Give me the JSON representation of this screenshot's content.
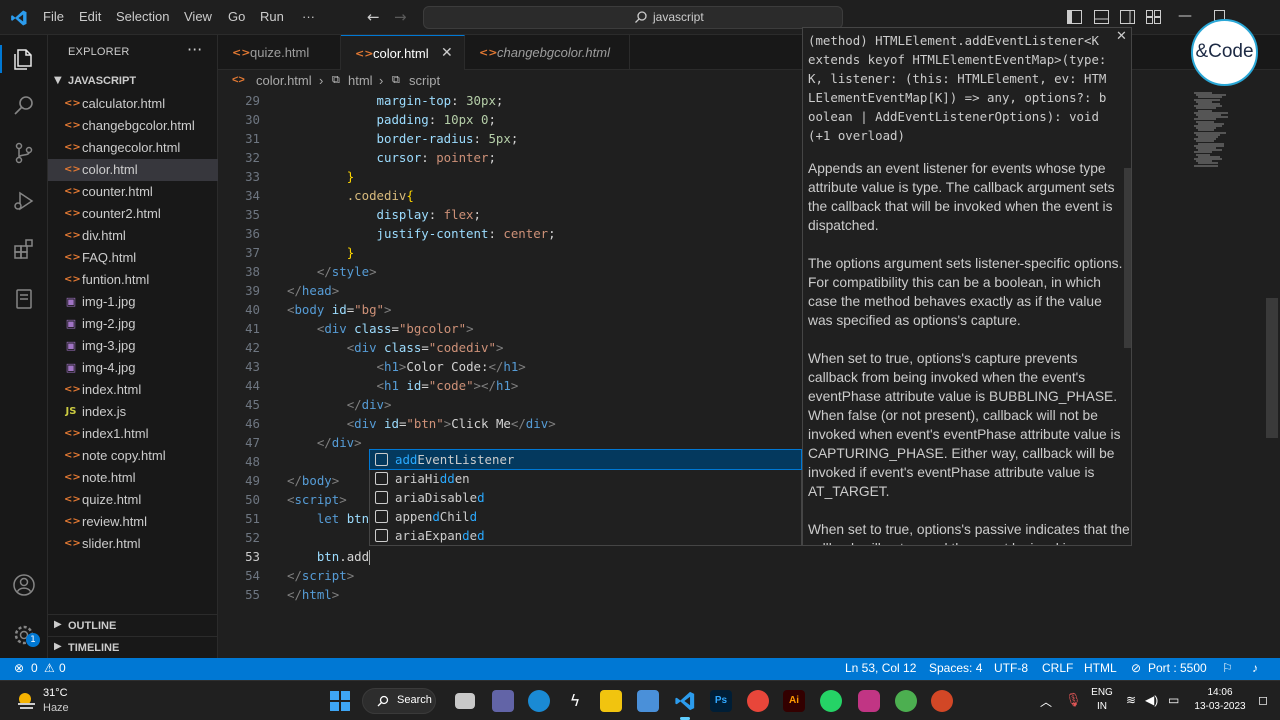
{
  "titlebar": {
    "menu": [
      "File",
      "Edit",
      "Selection",
      "View",
      "Go",
      "Run",
      "···"
    ],
    "search_text": "javascript"
  },
  "explorer": {
    "title": "EXPLORER",
    "more": "···",
    "folder": "JAVASCRIPT",
    "files": [
      {
        "name": "calculator.html",
        "kind": "html"
      },
      {
        "name": "changebgcolor.html",
        "kind": "html"
      },
      {
        "name": "changecolor.html",
        "kind": "html"
      },
      {
        "name": "color.html",
        "kind": "html",
        "selected": true
      },
      {
        "name": "counter.html",
        "kind": "html"
      },
      {
        "name": "counter2.html",
        "kind": "html"
      },
      {
        "name": "div.html",
        "kind": "html"
      },
      {
        "name": "FAQ.html",
        "kind": "html"
      },
      {
        "name": "funtion.html",
        "kind": "html"
      },
      {
        "name": "img-1.jpg",
        "kind": "image"
      },
      {
        "name": "img-2.jpg",
        "kind": "image"
      },
      {
        "name": "img-3.jpg",
        "kind": "image"
      },
      {
        "name": "img-4.jpg",
        "kind": "image"
      },
      {
        "name": "index.html",
        "kind": "html"
      },
      {
        "name": "index.js",
        "kind": "js"
      },
      {
        "name": "index1.html",
        "kind": "html"
      },
      {
        "name": "note copy.html",
        "kind": "html"
      },
      {
        "name": "note.html",
        "kind": "html"
      },
      {
        "name": "quize.html",
        "kind": "html"
      },
      {
        "name": "review.html",
        "kind": "html"
      },
      {
        "name": "slider.html",
        "kind": "html"
      }
    ],
    "outline": "OUTLINE",
    "timeline": "TIMELINE"
  },
  "tabs": [
    {
      "label": "quize.html",
      "active": false,
      "italic": false
    },
    {
      "label": "color.html",
      "active": true,
      "italic": false,
      "close": "✕"
    },
    {
      "label": "changebgcolor.html",
      "active": false,
      "italic": true
    }
  ],
  "breadcrumb": [
    "color.html",
    "html",
    "script"
  ],
  "editor": {
    "current_line": 53,
    "lines": [
      {
        "n": 29,
        "t": [
          [
            "            ",
            "t-text"
          ],
          [
            "margin-top",
            "t-prop"
          ],
          [
            ": ",
            "t-text"
          ],
          [
            "30px",
            "t-num"
          ],
          [
            ";",
            "t-text"
          ]
        ]
      },
      {
        "n": 30,
        "t": [
          [
            "            ",
            "t-text"
          ],
          [
            "padding",
            "t-prop"
          ],
          [
            ": ",
            "t-text"
          ],
          [
            "10px 0",
            "t-num"
          ],
          [
            ";",
            "t-text"
          ]
        ]
      },
      {
        "n": 31,
        "t": [
          [
            "            ",
            "t-text"
          ],
          [
            "border-radius",
            "t-prop"
          ],
          [
            ": ",
            "t-text"
          ],
          [
            "5px",
            "t-num"
          ],
          [
            ";",
            "t-text"
          ]
        ]
      },
      {
        "n": 32,
        "t": [
          [
            "            ",
            "t-text"
          ],
          [
            "cursor",
            "t-prop"
          ],
          [
            ": ",
            "t-text"
          ],
          [
            "pointer",
            "t-val"
          ],
          [
            ";",
            "t-text"
          ]
        ]
      },
      {
        "n": 33,
        "t": [
          [
            "        ",
            "t-text"
          ],
          [
            "}",
            "t-brace"
          ]
        ]
      },
      {
        "n": 34,
        "t": [
          [
            "        ",
            "t-text"
          ],
          [
            ".codediv",
            "t-sel"
          ],
          [
            "{",
            "t-brace"
          ]
        ]
      },
      {
        "n": 35,
        "t": [
          [
            "            ",
            "t-text"
          ],
          [
            "display",
            "t-prop"
          ],
          [
            ": ",
            "t-text"
          ],
          [
            "flex",
            "t-val"
          ],
          [
            ";",
            "t-text"
          ]
        ]
      },
      {
        "n": 36,
        "t": [
          [
            "            ",
            "t-text"
          ],
          [
            "justify-content",
            "t-prop"
          ],
          [
            ": ",
            "t-text"
          ],
          [
            "center",
            "t-val"
          ],
          [
            ";",
            "t-text"
          ]
        ]
      },
      {
        "n": 37,
        "t": [
          [
            "        ",
            "t-text"
          ],
          [
            "}",
            "t-brace"
          ]
        ]
      },
      {
        "n": 38,
        "t": [
          [
            "    ",
            "t-text"
          ],
          [
            "</",
            "t-tag"
          ],
          [
            "style",
            "t-name"
          ],
          [
            ">",
            "t-tag"
          ]
        ]
      },
      {
        "n": 39,
        "t": [
          [
            "</",
            "t-tag"
          ],
          [
            "head",
            "t-name"
          ],
          [
            ">",
            "t-tag"
          ]
        ]
      },
      {
        "n": 40,
        "t": [
          [
            "<",
            "t-tag"
          ],
          [
            "body",
            "t-name"
          ],
          [
            " ",
            "t-text"
          ],
          [
            "id",
            "t-attr"
          ],
          [
            "=",
            "t-text"
          ],
          [
            "\"bg\"",
            "t-str"
          ],
          [
            ">",
            "t-tag"
          ]
        ]
      },
      {
        "n": 41,
        "t": [
          [
            "    ",
            "t-text"
          ],
          [
            "<",
            "t-tag"
          ],
          [
            "div",
            "t-name"
          ],
          [
            " ",
            "t-text"
          ],
          [
            "class",
            "t-attr"
          ],
          [
            "=",
            "t-text"
          ],
          [
            "\"bgcolor\"",
            "t-str"
          ],
          [
            ">",
            "t-tag"
          ]
        ]
      },
      {
        "n": 42,
        "t": [
          [
            "        ",
            "t-text"
          ],
          [
            "<",
            "t-tag"
          ],
          [
            "div",
            "t-name"
          ],
          [
            " ",
            "t-text"
          ],
          [
            "class",
            "t-attr"
          ],
          [
            "=",
            "t-text"
          ],
          [
            "\"codediv\"",
            "t-str"
          ],
          [
            ">",
            "t-tag"
          ]
        ]
      },
      {
        "n": 43,
        "t": [
          [
            "            ",
            "t-text"
          ],
          [
            "<",
            "t-tag"
          ],
          [
            "h1",
            "t-name"
          ],
          [
            ">",
            "t-tag"
          ],
          [
            "Color Code:",
            "t-text"
          ],
          [
            "</",
            "t-tag"
          ],
          [
            "h1",
            "t-name"
          ],
          [
            ">",
            "t-tag"
          ]
        ]
      },
      {
        "n": 44,
        "t": [
          [
            "            ",
            "t-text"
          ],
          [
            "<",
            "t-tag"
          ],
          [
            "h1",
            "t-name"
          ],
          [
            " ",
            "t-text"
          ],
          [
            "id",
            "t-attr"
          ],
          [
            "=",
            "t-text"
          ],
          [
            "\"code\"",
            "t-str"
          ],
          [
            ">",
            "t-tag"
          ],
          [
            "</",
            "t-tag"
          ],
          [
            "h1",
            "t-name"
          ],
          [
            ">",
            "t-tag"
          ]
        ]
      },
      {
        "n": 45,
        "t": [
          [
            "        ",
            "t-text"
          ],
          [
            "</",
            "t-tag"
          ],
          [
            "div",
            "t-name"
          ],
          [
            ">",
            "t-tag"
          ]
        ]
      },
      {
        "n": 46,
        "t": [
          [
            "        ",
            "t-text"
          ],
          [
            "<",
            "t-tag"
          ],
          [
            "div",
            "t-name"
          ],
          [
            " ",
            "t-text"
          ],
          [
            "id",
            "t-attr"
          ],
          [
            "=",
            "t-text"
          ],
          [
            "\"btn\"",
            "t-str"
          ],
          [
            ">",
            "t-tag"
          ],
          [
            "Click Me",
            "t-text"
          ],
          [
            "</",
            "t-tag"
          ],
          [
            "div",
            "t-name"
          ],
          [
            ">",
            "t-tag"
          ]
        ]
      },
      {
        "n": 47,
        "t": [
          [
            "    ",
            "t-text"
          ],
          [
            "</",
            "t-tag"
          ],
          [
            "div",
            "t-name"
          ],
          [
            ">",
            "t-tag"
          ]
        ]
      },
      {
        "n": 48,
        "t": []
      },
      {
        "n": 49,
        "t": [
          [
            "</",
            "t-tag"
          ],
          [
            "body",
            "t-name"
          ],
          [
            ">",
            "t-tag"
          ]
        ]
      },
      {
        "n": 50,
        "t": [
          [
            "<",
            "t-tag"
          ],
          [
            "script",
            "t-name"
          ],
          [
            ">",
            "t-tag"
          ]
        ]
      },
      {
        "n": 51,
        "t": [
          [
            "    ",
            "t-text"
          ],
          [
            "let",
            "t-kw"
          ],
          [
            " ",
            "t-text"
          ],
          [
            "btn",
            "t-var"
          ]
        ]
      },
      {
        "n": 52,
        "t": []
      },
      {
        "n": 53,
        "t": [
          [
            "    ",
            "t-text"
          ],
          [
            "btn",
            "t-var"
          ],
          [
            ".add",
            "t-text"
          ]
        ]
      },
      {
        "n": 54,
        "t": [
          [
            "</",
            "t-tag"
          ],
          [
            "script",
            "t-name"
          ],
          [
            ">",
            "t-tag"
          ]
        ]
      },
      {
        "n": 55,
        "t": [
          [
            "</",
            "t-tag"
          ],
          [
            "html",
            "t-name"
          ],
          [
            ">",
            "t-tag"
          ]
        ]
      }
    ]
  },
  "suggestions": [
    {
      "match": "add",
      "rest": "EventListener",
      "focused": true
    },
    {
      "pre": "aria",
      "match": "",
      "rest": "Hidden",
      "hl": [
        [
          "ariaHi",
          ""
        ],
        [
          "dd",
          "b"
        ],
        [
          "en",
          ""
        ]
      ]
    },
    {
      "hl": [
        [
          "ariaDisable",
          ""
        ],
        [
          "d",
          "b"
        ]
      ]
    },
    {
      "hl": [
        [
          "appen",
          ""
        ],
        [
          "d",
          "b"
        ],
        [
          "Chil",
          ""
        ],
        [
          "d",
          "b"
        ]
      ]
    },
    {
      "hl": [
        [
          "ariaExpan",
          ""
        ],
        [
          "d",
          "b"
        ],
        [
          "e",
          ""
        ],
        [
          "d",
          "b"
        ]
      ]
    }
  ],
  "details": {
    "signature": "(method) HTMLElement.addEventListener<K extends keyof HTMLElementEventMap>(type: K, listener: (this: HTMLElement, ev: HTMLElementEventMap[K]) => any, options?: boolean | AddEventListenerOptions): void (+1 overload)",
    "paragraphs": [
      "Appends an event listener for events whose type attribute value is type. The callback argument sets the callback that will be invoked when the event is dispatched.",
      "The options argument sets listener-specific options. For compatibility this can be a boolean, in which case the method behaves exactly as if the value was specified as options's capture.",
      "When set to true, options's capture prevents callback from being invoked when the event's eventPhase attribute value is BUBBLING_PHASE. When false (or not present), callback will not be invoked when event's eventPhase attribute value is CAPTURING_PHASE. Either way, callback will be invoked if event's eventPhase attribute value is AT_TARGET.",
      "When set to true, options's passive indicates that the callback will not cancel the event by invoking"
    ]
  },
  "brand": {
    "text": "&Code"
  },
  "statusbar": {
    "errors": "0",
    "warnings": "0",
    "position": "Ln 53, Col 12",
    "spaces": "Spaces: 4",
    "encoding": "UTF-8",
    "eol": "CRLF",
    "language": "HTML",
    "port": "Port : 5500"
  },
  "taskbar": {
    "temp": "31°C",
    "weather": "Haze",
    "search": "Search",
    "lang_top": "ENG",
    "lang_bottom": "IN",
    "time": "14:06",
    "date": "13-03-2023",
    "settings_badge": "1"
  }
}
